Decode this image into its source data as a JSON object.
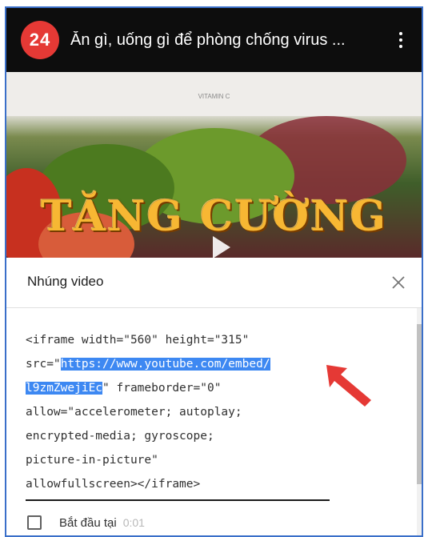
{
  "header": {
    "channel_logo_text": "24",
    "title": "Ăn gì, uống gì để phòng chống virus ...",
    "menu_icon": "more-vertical-icon"
  },
  "thumbnail": {
    "caption": "VITAMIN C",
    "overlay_text": "TĂNG CƯỜNG"
  },
  "dialog": {
    "title": "Nhúng video",
    "close_icon": "close-icon",
    "code_line1": "<iframe width=\"560\" height=\"315\"",
    "code_line2_prefix": "src=\"",
    "code_url_part1": "https://www.youtube.com/embed/",
    "code_url_part2": "l9zmZwejiEc",
    "code_line3_suffix": "\" frameborder=\"0\"",
    "code_line4": "allow=\"accelerometer; autoplay;",
    "code_line5": "encrypted-media; gyroscope;",
    "code_line6": "picture-in-picture\"",
    "code_line7": "allowfullscreen></iframe>",
    "start_label": "Bắt đầu tại",
    "start_time": "0:01"
  },
  "colors": {
    "selection": "#3d88f2",
    "arrow": "#e53935",
    "frame_border": "#3a6fc9"
  }
}
